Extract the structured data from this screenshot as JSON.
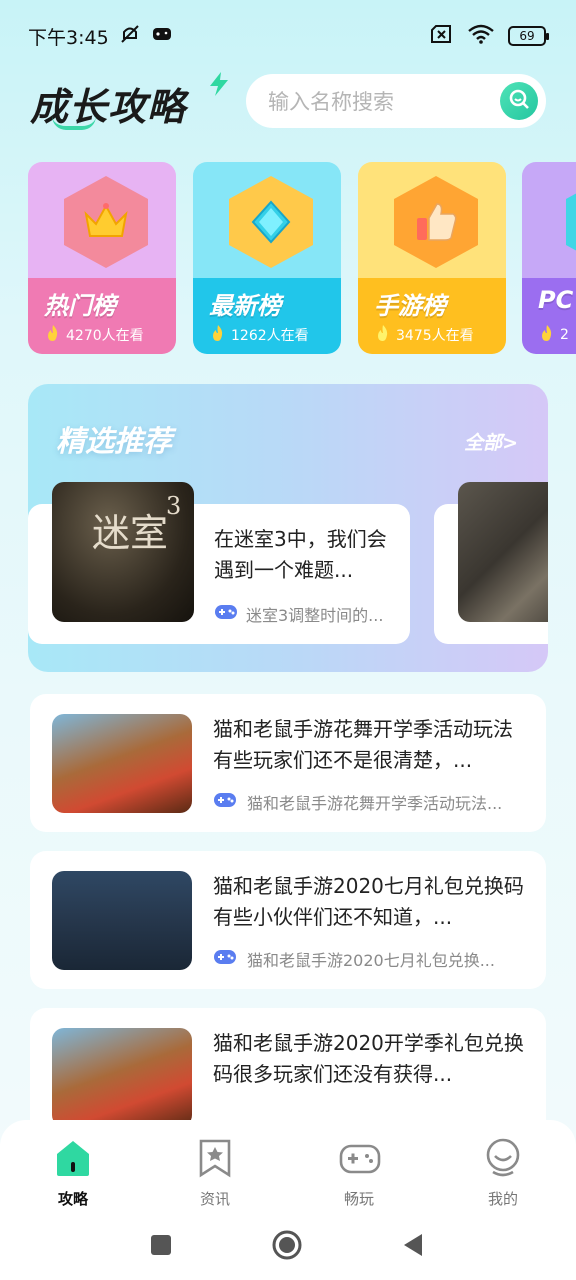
{
  "status_bar": {
    "time": "下午3:45",
    "battery": "69"
  },
  "header": {
    "logo": "成长攻略",
    "search_placeholder": "输入名称搜索"
  },
  "categories": [
    {
      "name": "热门榜",
      "viewers": "4270人在看"
    },
    {
      "name": "最新榜",
      "viewers": "1262人在看"
    },
    {
      "name": "手游榜",
      "viewers": "3475人在看"
    },
    {
      "name": "PC",
      "viewers": "2"
    }
  ],
  "featured": {
    "title": "精选推荐",
    "all_label": "全部>",
    "card": {
      "thumb_text": "迷室",
      "thumb_number": "3",
      "title": "在迷室3中，我们会遇到一个难题...",
      "source": "迷室3调整时间的..."
    }
  },
  "articles": [
    {
      "title": "猫和老鼠手游花舞开学季活动玩法有些玩家们还不是很清楚，...",
      "source": "猫和老鼠手游花舞开学季活动玩法..."
    },
    {
      "title": "猫和老鼠手游2020七月礼包兑换码有些小伙伴们还不知道，...",
      "source": "猫和老鼠手游2020七月礼包兑换..."
    },
    {
      "title": "猫和老鼠手游2020开学季礼包兑换码很多玩家们还没有获得...",
      "source": ""
    }
  ],
  "bottom_nav": [
    {
      "label": "攻略"
    },
    {
      "label": "资讯"
    },
    {
      "label": "畅玩"
    },
    {
      "label": "我的"
    }
  ],
  "colors": {
    "accent": "#2fd8a1"
  }
}
